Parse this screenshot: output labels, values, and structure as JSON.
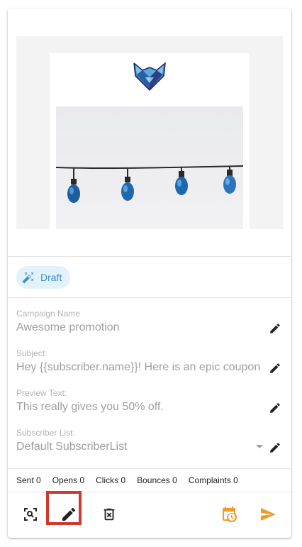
{
  "status": {
    "label": "Draft",
    "accent": "#3d8fd4",
    "chip_bg": "#e3f1fb"
  },
  "fields": [
    {
      "label": "Campaign Name",
      "value": "Awesome promotion"
    },
    {
      "label": "Subject:",
      "value": "Hey {{subscriber.name}}! Here is an epic coupon"
    },
    {
      "label": "Preview Text:",
      "value": "This really gives you 50% off."
    },
    {
      "label": "Subscriber List:",
      "value": "Default SubscriberList"
    }
  ],
  "stats": {
    "sent": "Sent 0",
    "opens": "Opens 0",
    "clicks": "Clicks 0",
    "bounces": "Bounces 0",
    "complaints": "Complaints 0"
  },
  "icons": {
    "preview": "magnify-icon",
    "edit": "pencil-icon",
    "delete": "trash-icon",
    "schedule": "calendar-clock-icon",
    "send": "send-icon"
  },
  "colors": {
    "schedule": "#f29b26",
    "send": "#f29b26",
    "highlight": "#d0382d"
  }
}
